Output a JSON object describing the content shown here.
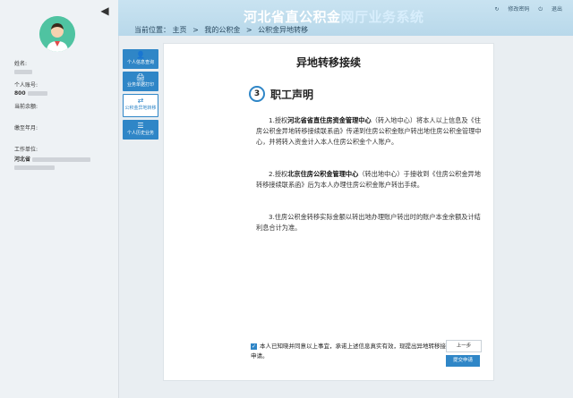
{
  "header": {
    "brand_main": "河北省直公积金",
    "brand_sub": "网厅业务系统",
    "change_pwd": "修改密码",
    "logout": "退出"
  },
  "breadcrumb": {
    "prefix": "当前位置：",
    "items": [
      "主页",
      "我的公积金",
      "公积金异地转移"
    ],
    "sep": ">"
  },
  "profile": {
    "name_label": "姓名:",
    "account_label": "个人账号:",
    "account_value": "800",
    "balance_label": "当前余额:",
    "paid_until_label": "缴至年月:",
    "employer_label": "工作单位:",
    "employer_value": "河北省"
  },
  "leftnav": [
    {
      "icon": "person-icon",
      "label": "个人信息查询"
    },
    {
      "icon": "print-icon",
      "label": "业务单据打印"
    },
    {
      "icon": "transfer-icon",
      "label": "公积金异地转移"
    },
    {
      "icon": "history-icon",
      "label": "个人历史业务"
    }
  ],
  "main": {
    "title": "异地转移接续",
    "step_number": "3",
    "step_title": "职工声明",
    "p1_a": "1.授权",
    "p1_org": "河北省省直住房资金管理中心",
    "p1_b": "（转入地中心）将本人以上信息及《住房公积金异地转移接续联系函》传递到住房公积金账户转出地住房公积金管理中心，并将转入资金计入本人住房公积金个人账户。",
    "p2_a": "2.授权",
    "p2_org": "北京住房公积金管理中心",
    "p2_b": "（转出地中心）于接收到《住房公积金异地转移接续联系函》后为本人办理住房公积金账户转出手续。",
    "p3": "3.住房公积金转移实际金额以转出地办理账户转出时的账户本金余额及计结利息合计为准。",
    "agree_text": "本人已知晓并同意以上事宜，承诺上述信息真实有效，现提出异地转移接续申请。",
    "prev_button": "上一步",
    "submit_button": "提交申请"
  }
}
